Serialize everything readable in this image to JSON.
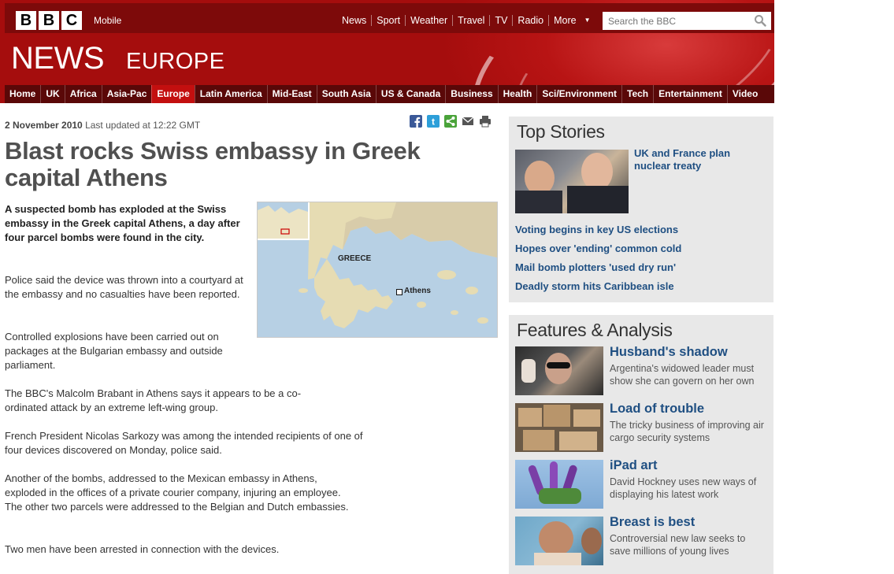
{
  "header": {
    "logo_letters": [
      "B",
      "B",
      "C"
    ],
    "mobile_label": "Mobile",
    "top_nav": [
      "News",
      "Sport",
      "Weather",
      "Travel",
      "TV",
      "Radio"
    ],
    "more_label": "More",
    "search_placeholder": "Search the BBC",
    "news_label": "NEWS",
    "section_label": "EUROPE"
  },
  "section_nav": {
    "items": [
      "Home",
      "UK",
      "Africa",
      "Asia-Pac",
      "Europe",
      "Latin America",
      "Mid-East",
      "South Asia",
      "US & Canada",
      "Business",
      "Health",
      "Sci/Environment",
      "Tech",
      "Entertainment",
      "Video"
    ],
    "active": "Europe"
  },
  "article": {
    "date": "2 November 2010",
    "last_updated": "Last updated at 12:22 GMT",
    "share_icons": [
      "facebook-icon",
      "twitter-icon",
      "share-icon",
      "email-icon",
      "print-icon"
    ],
    "headline": "Blast rocks Swiss embassy in Greek capital Athens",
    "intro": "A suspected bomb has exploded at the Swiss embassy in the Greek capital Athens, a day after four parcel bombs were found in the city.",
    "paragraphs": [
      "Police said the device was thrown into a courtyard at the embassy and no casualties have been reported.",
      "Controlled explosions have been carried out on packages at the Bulgarian embassy and outside parliament.",
      "The BBC's Malcolm Brabant in Athens says it appears to be a co-ordinated attack by an extreme left-wing group.",
      "French President Nicolas Sarkozy was among the intended recipients of one of four devices discovered on Monday, police said.",
      "Another of the bombs, addressed to the Mexican embassy in Athens, exploded in the offices of a private courier company, injuring an employee. The other two parcels were addressed to the Belgian and Dutch embassies.",
      "Two men have been arrested in connection with the devices."
    ],
    "map": {
      "country_label": "GREECE",
      "city_label": "Athens"
    }
  },
  "top_stories": {
    "title": "Top Stories",
    "lead": "UK and France plan nuclear treaty",
    "links": [
      "Voting begins in key US elections",
      "Hopes over 'ending' common cold",
      "Mail bomb plotters 'used dry run'",
      "Deadly storm hits Caribbean isle"
    ]
  },
  "features": {
    "title": "Features & Analysis",
    "items": [
      {
        "title": "Husband's shadow",
        "desc": "Argentina's widowed leader must show she can govern on her own"
      },
      {
        "title": "Load of trouble",
        "desc": "The tricky business of improving air cargo security systems"
      },
      {
        "title": "iPad art",
        "desc": "David Hockney uses new ways of displaying his latest work"
      },
      {
        "title": "Breast is best",
        "desc": "Controversial new law seeks to save millions of young lives"
      }
    ]
  }
}
